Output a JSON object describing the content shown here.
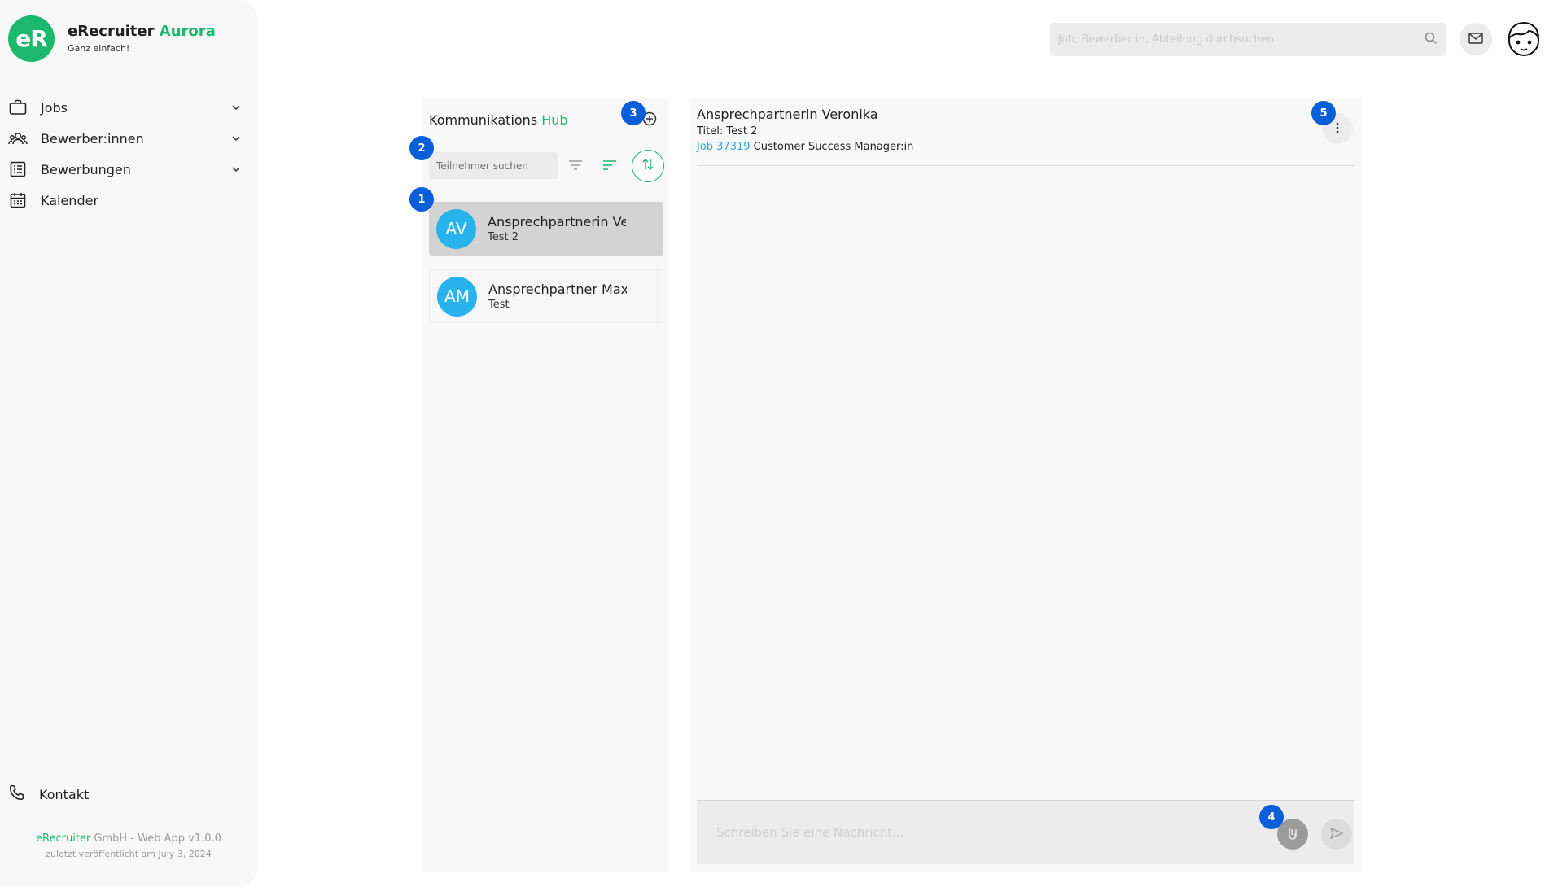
{
  "brand": {
    "logo": "eR",
    "name": "eRecruiter",
    "name_accent": "Aurora",
    "tagline": "Ganz einfach!"
  },
  "sidebar": {
    "items": [
      {
        "label": "Jobs",
        "icon": "briefcase-icon"
      },
      {
        "label": "Bewerber:innen",
        "icon": "people-icon"
      },
      {
        "label": "Bewerbungen",
        "icon": "list-icon"
      },
      {
        "label": "Kalender",
        "icon": "calendar-icon"
      }
    ],
    "contact_label": "Kontakt",
    "footer_company_accent": "eRecruiter",
    "footer_company_rest": " GmbH - Web App v1.0.0",
    "footer_release": "zuletzt veröffentlicht am July 3, 2024"
  },
  "topbar": {
    "search_placeholder": "Job, Bewerber:in, Abteilung durchsuchen"
  },
  "hub": {
    "title": "Kommunikations",
    "title_accent": "Hub",
    "search_placeholder": "Teilnehmer suchen",
    "contacts": [
      {
        "initials": "AV",
        "name": "Ansprechpartnerin Veronika",
        "subtitle": "Test 2",
        "active": true
      },
      {
        "initials": "AM",
        "name": "Ansprechpartner Maxmilian",
        "subtitle": "Test",
        "active": false
      }
    ]
  },
  "chat": {
    "title": "Ansprechpartnerin Veronika",
    "subtitle": "Titel: Test 2",
    "job_link": "Job 37319",
    "job_title": " Customer Success Manager:in",
    "composer_placeholder": "Schreiben Sie eine Nachricht..."
  },
  "badges": [
    "1",
    "2",
    "3",
    "4",
    "5"
  ],
  "colors": {
    "accent": "#1bb86e",
    "avatar": "#29b3ec",
    "badge": "#0a5fd8",
    "link": "#29a8e0"
  }
}
